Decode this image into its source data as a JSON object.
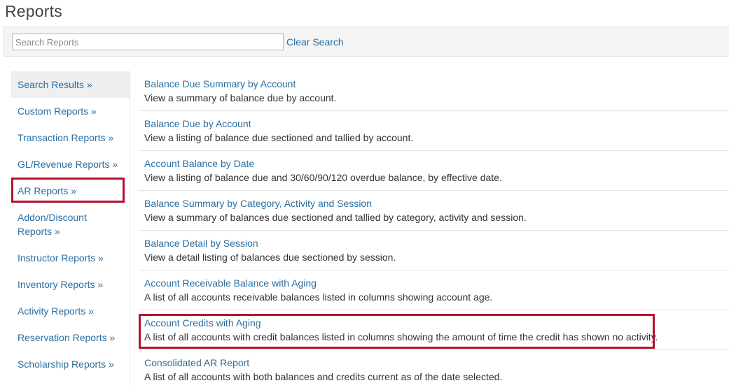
{
  "page": {
    "title": "Reports"
  },
  "search": {
    "placeholder": "Search Reports",
    "value": "",
    "clear_label": "Clear Search"
  },
  "sidebar": {
    "items": [
      {
        "label": "Search Results »",
        "active": true
      },
      {
        "label": "Custom Reports »"
      },
      {
        "label": "Transaction Reports »"
      },
      {
        "label": "GL/Revenue Reports »"
      },
      {
        "label": "AR Reports »",
        "highlighted": true
      },
      {
        "label": "Addon/Discount Reports »"
      },
      {
        "label": "Instructor Reports »"
      },
      {
        "label": "Inventory Reports »"
      },
      {
        "label": "Activity Reports »"
      },
      {
        "label": "Reservation Reports »"
      },
      {
        "label": "Scholarship Reports »"
      }
    ]
  },
  "reports": [
    {
      "title": "Balance Due Summary by Account",
      "description": "View a summary of balance due by account."
    },
    {
      "title": "Balance Due by Account",
      "description": "View a listing of balance due sectioned and tallied by account."
    },
    {
      "title": "Account Balance by Date",
      "description": "View a listing of balance due and 30/60/90/120 overdue balance, by effective date."
    },
    {
      "title": "Balance Summary by Category, Activity and Session",
      "description": "View a summary of balances due sectioned and tallied by category, activity and session."
    },
    {
      "title": "Balance Detail by Session",
      "description": "View a detail listing of balances due sectioned by session."
    },
    {
      "title": "Account Receivable Balance with Aging",
      "description": "A list of all accounts receivable balances listed in columns showing account age."
    },
    {
      "title": "Account Credits with Aging",
      "description": "A list of all accounts with credit balances listed in columns showing the amount of time the credit has shown no activity.",
      "highlighted": true
    },
    {
      "title": "Consolidated AR Report",
      "description": "A list of all accounts with both balances and credits current as of the date selected."
    }
  ],
  "colors": {
    "link": "#2b6ea0",
    "highlight": "#b5122e",
    "text": "#333333"
  }
}
